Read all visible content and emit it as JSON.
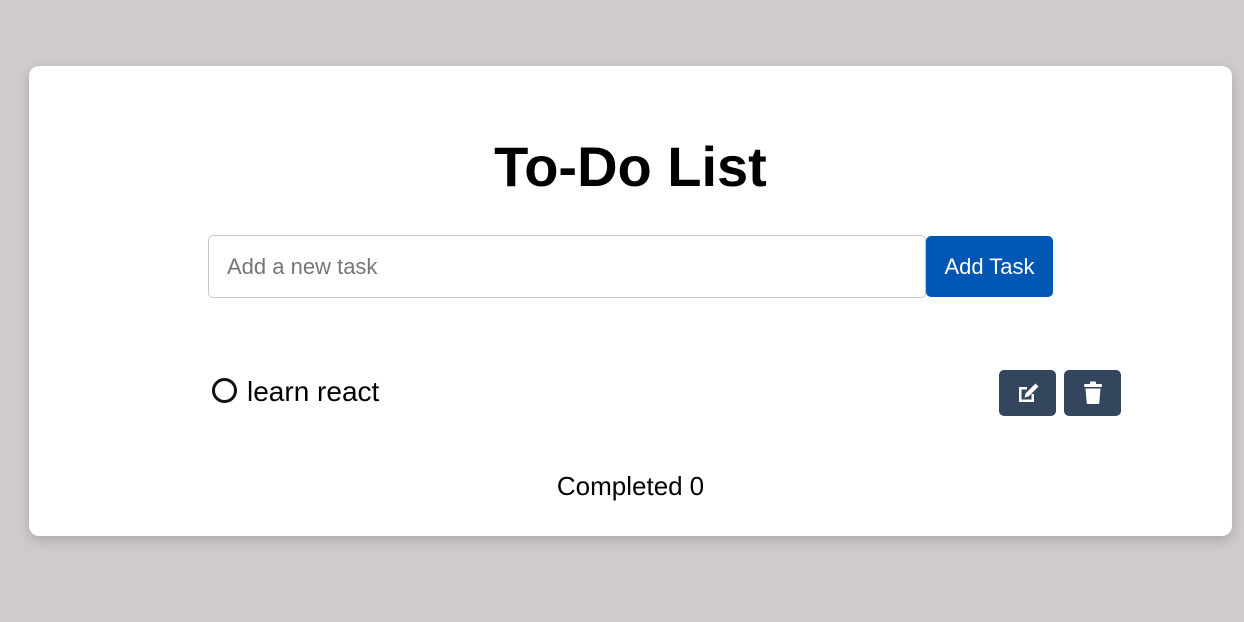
{
  "app": {
    "title": "To-Do List"
  },
  "new_task": {
    "placeholder": "Add a new task",
    "value": "",
    "add_label": "Add Task"
  },
  "tasks": [
    {
      "text": "learn react",
      "completed": false
    }
  ],
  "footer": {
    "completed_label": "Completed",
    "completed_count": "0"
  },
  "colors": {
    "page_background": "#cfcbca",
    "card_background": "#ffffff",
    "add_button": "#0056b3",
    "icon_button": "#34465d"
  },
  "icons": {
    "task_status": "circle-outline-icon",
    "edit": "edit-icon",
    "delete": "trash-icon"
  }
}
